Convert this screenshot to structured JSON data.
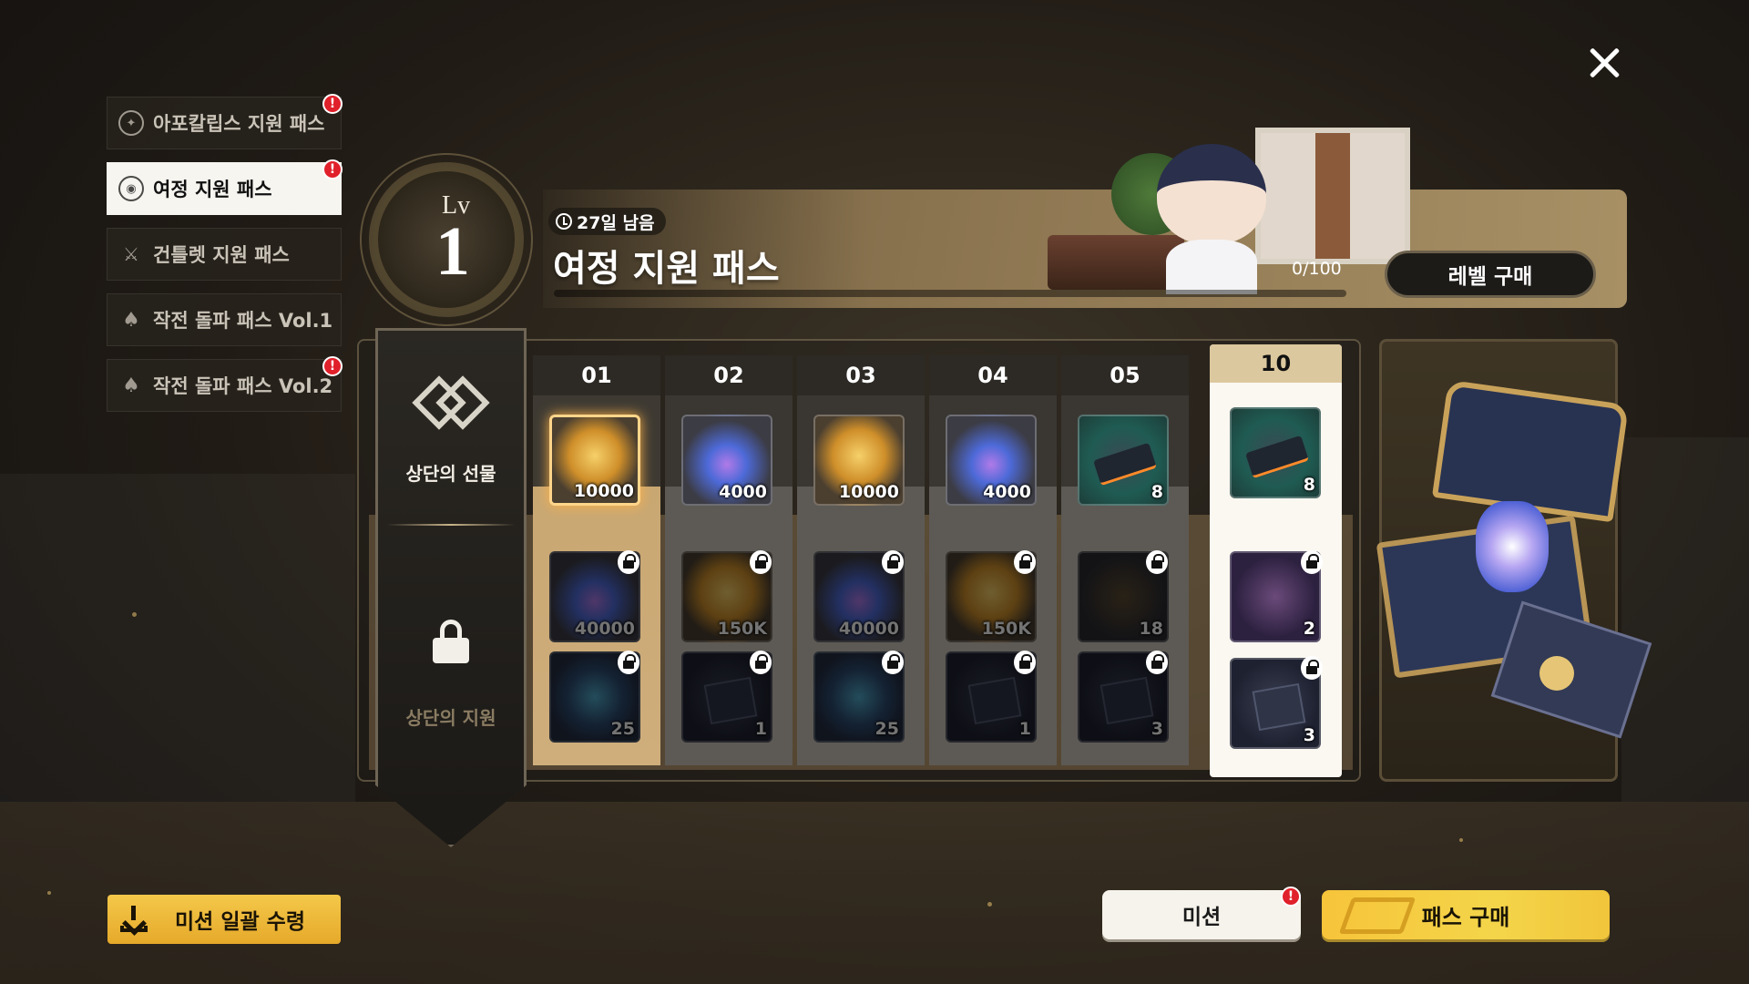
{
  "sidebar": {
    "items": [
      {
        "label": "아포칼립스 지원 패스",
        "active": false,
        "alert": true
      },
      {
        "label": "여정 지원 패스",
        "active": true,
        "alert": true
      },
      {
        "label": "건틀렛 지원 패스",
        "active": false,
        "alert": false
      },
      {
        "label": "작전 돌파 패스 Vol.1",
        "active": false,
        "alert": false
      },
      {
        "label": "작전 돌파 패스 Vol.2",
        "active": false,
        "alert": true
      }
    ],
    "alert_mark": "!",
    "collect_all_label": "미션 일괄 수령"
  },
  "level": {
    "prefix": "Lv",
    "value": "1"
  },
  "header": {
    "timer": "27일 남음",
    "title": "여정 지원 패스",
    "progress_text": "0/100",
    "progress_fraction": 0,
    "level_buy_label": "레벨 구매"
  },
  "track": {
    "free_label": "상단의 선물",
    "premium_label": "상단의 지원",
    "columns": [
      {
        "level": "01",
        "free": {
          "icon": "gold-coin-icon",
          "qty": "10000"
        },
        "premium": [
          {
            "icon": "potion-icon",
            "qty": "40000"
          },
          {
            "icon": "orb-icon",
            "qty": "25"
          }
        ]
      },
      {
        "level": "02",
        "free": {
          "icon": "potion-icon",
          "qty": "4000"
        },
        "premium": [
          {
            "icon": "gold-coin-icon",
            "qty": "150K"
          },
          {
            "icon": "letter-icon",
            "qty": "1"
          }
        ]
      },
      {
        "level": "03",
        "free": {
          "icon": "gold-coin-icon",
          "qty": "10000"
        },
        "premium": [
          {
            "icon": "potion-icon",
            "qty": "40000"
          },
          {
            "icon": "orb-icon",
            "qty": "25"
          }
        ]
      },
      {
        "level": "04",
        "free": {
          "icon": "potion-icon",
          "qty": "4000"
        },
        "premium": [
          {
            "icon": "gold-coin-icon",
            "qty": "150K"
          },
          {
            "icon": "letter-icon",
            "qty": "1"
          }
        ]
      },
      {
        "level": "05",
        "free": {
          "icon": "gem-icon",
          "qty": "8"
        },
        "premium": [
          {
            "icon": "chest-icon",
            "qty": "18"
          },
          {
            "icon": "letter-icon",
            "qty": "3"
          }
        ]
      },
      {
        "level": "10",
        "free": {
          "icon": "gem-icon",
          "qty": "8"
        },
        "premium": [
          {
            "icon": "chest-icon",
            "qty": "2"
          },
          {
            "icon": "letter-icon",
            "qty": "3"
          }
        ]
      }
    ]
  },
  "buttons": {
    "mission": "미션",
    "pass_buy": "패스 구매"
  },
  "colors": {
    "accent_gold": "#f4c84a",
    "alert_red": "#e0202a",
    "active_tab_bg": "#f7f5f0"
  }
}
